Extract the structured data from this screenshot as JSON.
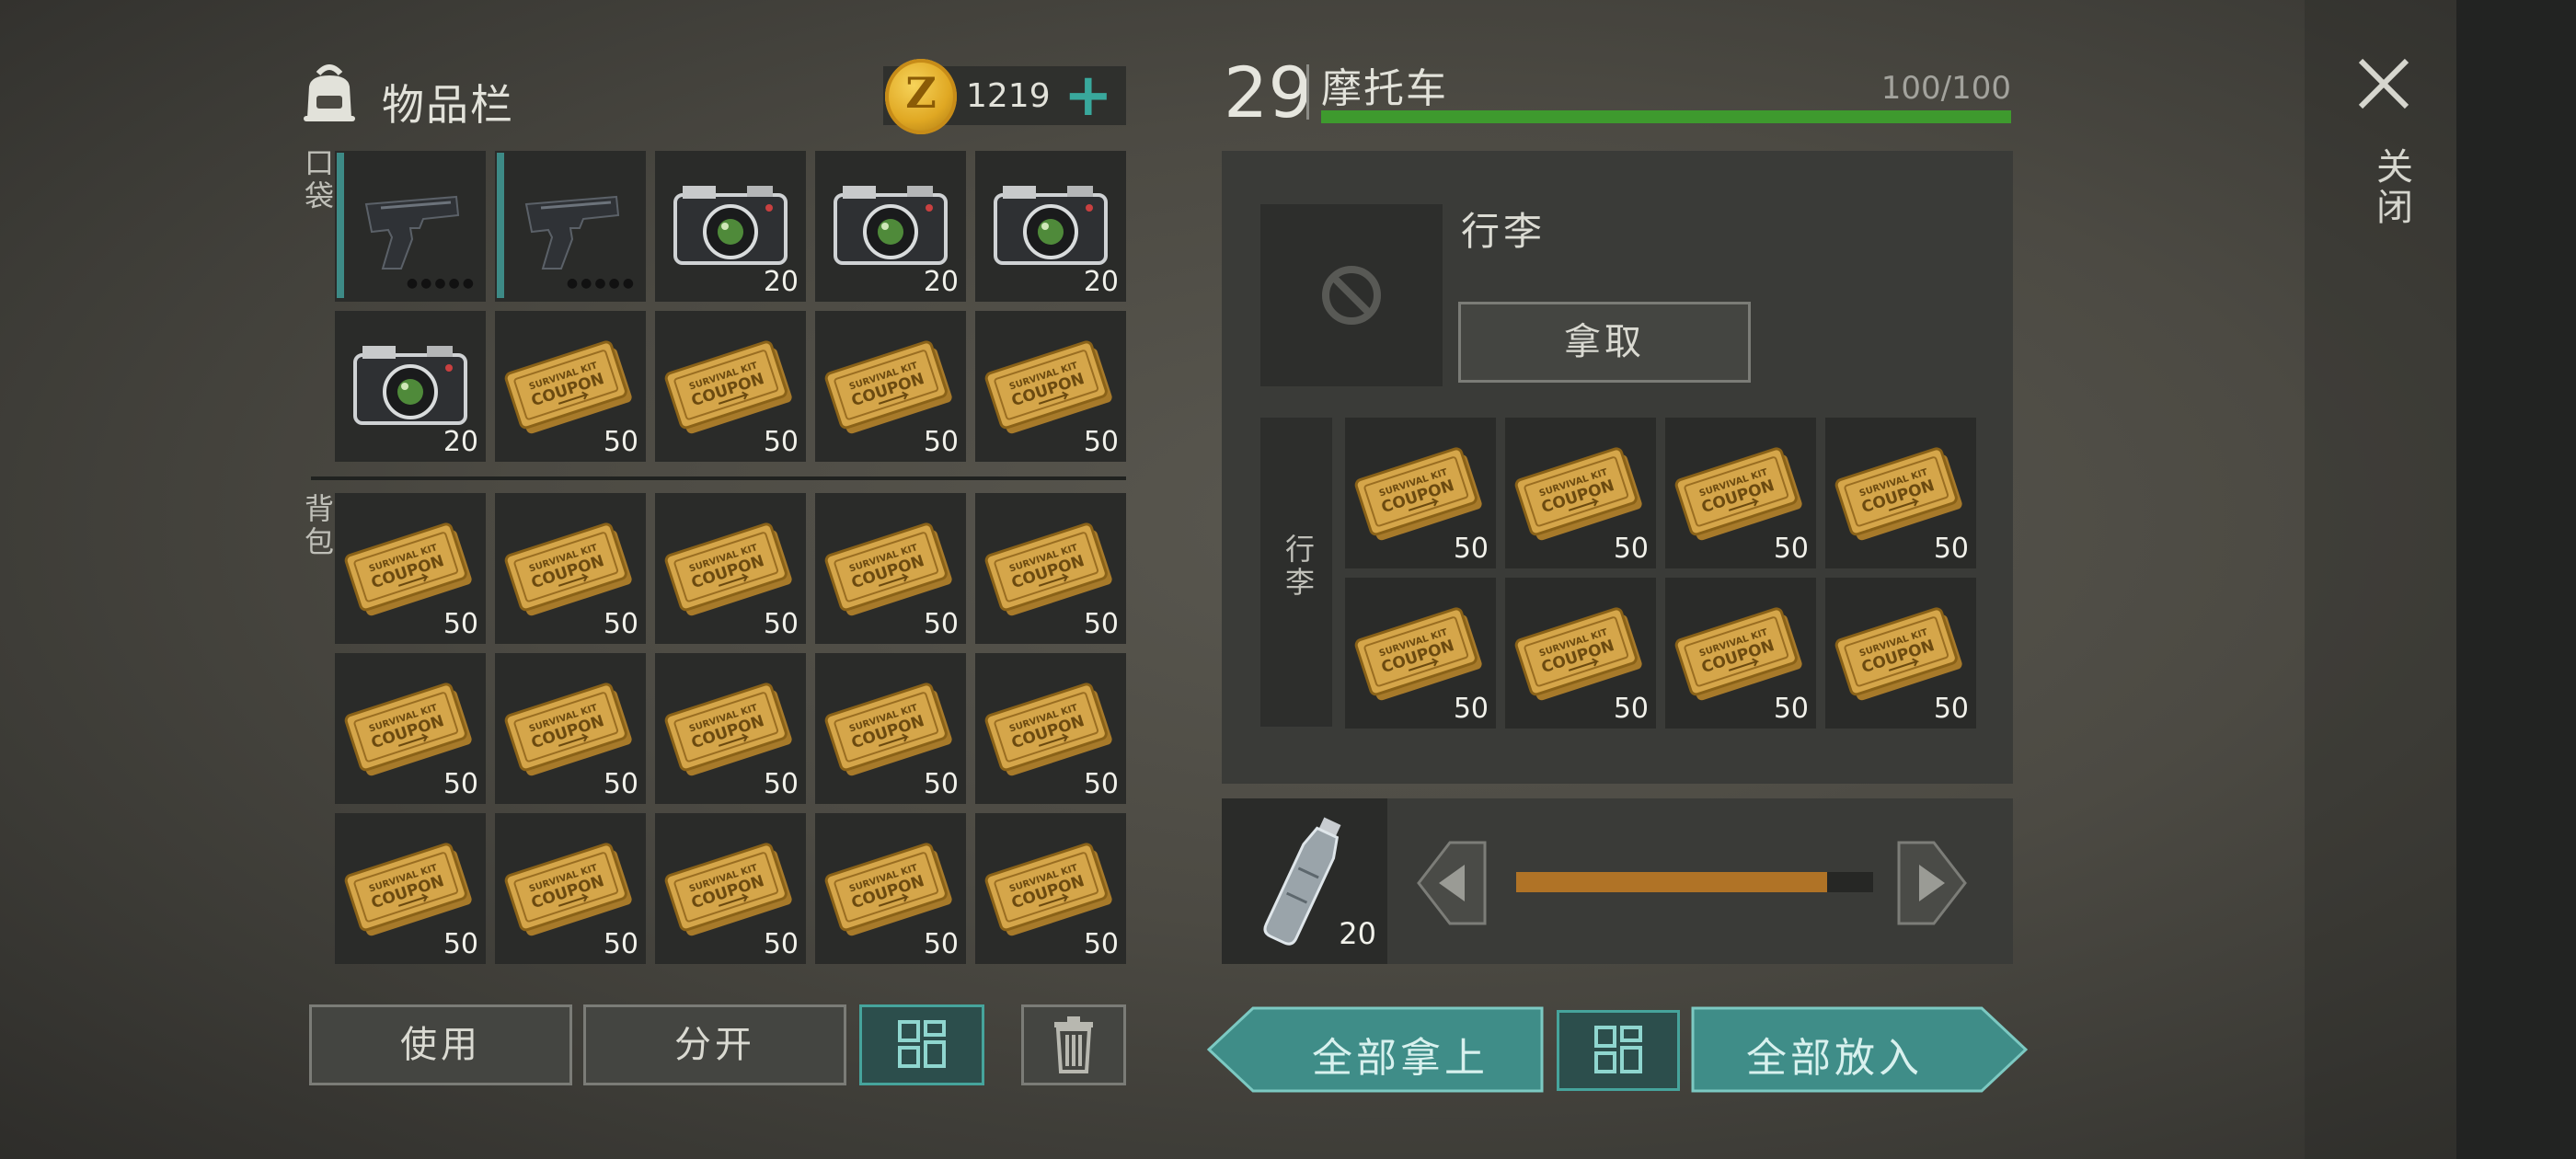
{
  "inventory": {
    "title": "物品栏",
    "currency": "1219",
    "coin_symbol": "Z",
    "plus_label": "+",
    "pocket_label": "口袋",
    "backpack_label": "背包",
    "pocket_slots": [
      {
        "item": "pistol",
        "qty": "",
        "durability": "●●●●●"
      },
      {
        "item": "pistol",
        "qty": "",
        "durability": "●●●●●"
      },
      {
        "item": "camera",
        "qty": "20"
      },
      {
        "item": "camera",
        "qty": "20"
      },
      {
        "item": "camera",
        "qty": "20"
      },
      {
        "item": "camera",
        "qty": "20"
      },
      {
        "item": "coupon",
        "qty": "50"
      },
      {
        "item": "coupon",
        "qty": "50"
      },
      {
        "item": "coupon",
        "qty": "50"
      },
      {
        "item": "coupon",
        "qty": "50"
      }
    ],
    "backpack_slots": [
      {
        "item": "coupon",
        "qty": "50"
      },
      {
        "item": "coupon",
        "qty": "50"
      },
      {
        "item": "coupon",
        "qty": "50"
      },
      {
        "item": "coupon",
        "qty": "50"
      },
      {
        "item": "coupon",
        "qty": "50"
      },
      {
        "item": "coupon",
        "qty": "50"
      },
      {
        "item": "coupon",
        "qty": "50"
      },
      {
        "item": "coupon",
        "qty": "50"
      },
      {
        "item": "coupon",
        "qty": "50"
      },
      {
        "item": "coupon",
        "qty": "50"
      },
      {
        "item": "coupon",
        "qty": "50"
      },
      {
        "item": "coupon",
        "qty": "50"
      },
      {
        "item": "coupon",
        "qty": "50"
      },
      {
        "item": "coupon",
        "qty": "50"
      },
      {
        "item": "coupon",
        "qty": "50"
      }
    ],
    "use_label": "使用",
    "split_label": "分开"
  },
  "vehicle": {
    "level": "29",
    "name": "摩托车",
    "durability": "100/100",
    "durability_fraction": 1.0,
    "luggage_title": "行李",
    "luggage_side_label": "行李",
    "take_label": "拿取",
    "luggage_slots": [
      {
        "item": "coupon",
        "qty": "50"
      },
      {
        "item": "coupon",
        "qty": "50"
      },
      {
        "item": "coupon",
        "qty": "50"
      },
      {
        "item": "coupon",
        "qty": "50"
      },
      {
        "item": "coupon",
        "qty": "50"
      },
      {
        "item": "coupon",
        "qty": "50"
      },
      {
        "item": "coupon",
        "qty": "50"
      },
      {
        "item": "coupon",
        "qty": "50"
      }
    ],
    "fuel_item": {
      "item": "bottle",
      "qty": "20"
    },
    "fuel_fraction": 0.87
  },
  "actions": {
    "take_all_label": "全部拿上",
    "put_all_label": "全部放入"
  },
  "close_label": "关闭",
  "coupon_text": {
    "line1": "SURVIVAL KIT",
    "line2": "COUPON"
  },
  "colors": {
    "accent": "#3d8a86",
    "hp": "#3e9a2e",
    "fuel": "#b07326"
  }
}
